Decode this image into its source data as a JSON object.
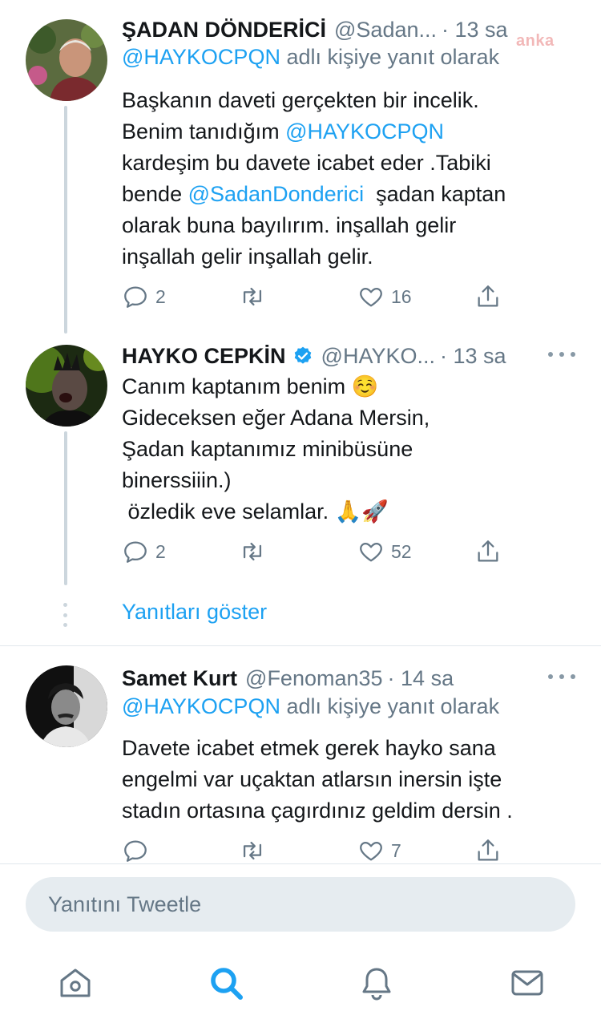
{
  "watermark": "anka",
  "tweets": [
    {
      "name": "ŞADAN DÖNDERİCİ",
      "handle": "@Sadan...",
      "time": "· 13 sa",
      "replying_mention": "@HAYKOCPQN",
      "replying_suffix": " adlı kişiye yanıt olarak",
      "text": {
        "p1": "Başkanın daveti gerçekten bir incelik.\nBenim tanıdığım ",
        "m1": "@HAYKOCPQN",
        "p2": "\nkardeşim bu davete icabet eder .Tabiki\nbende ",
        "m2": "@SadanDonderici",
        "p3": "  şadan kaptan\nolarak buna bayılırım. inşallah gelir\ninşallah gelir inşallah gelir."
      },
      "replies": "2",
      "retweets": "",
      "likes": "16"
    },
    {
      "name": "HAYKO CEPKİN",
      "handle": "@HAYKO...",
      "time": "· 13 sa",
      "verified": true,
      "text": "Canım kaptanım benim ☺️\nGideceksen eğer Adana Mersin,\nŞadan kaptanımız minibüsüne\nbinerssiiin.)\n özledik eve selamlar. 🙏🚀",
      "replies": "2",
      "retweets": "",
      "likes": "52"
    },
    {
      "name": "Samet Kurt",
      "handle": "@Fenoman35",
      "time": "· 14 sa",
      "replying_mention": "@HAYKOCPQN",
      "replying_suffix": " adlı kişiye yanıt olarak",
      "text": "Davete icabet etmek gerek hayko sana\nengelmi var uçaktan atlarsın inersin işte\nstadın ortasına çagırdınız geldim dersin .",
      "replies": "",
      "retweets": "",
      "likes": "7"
    }
  ],
  "show_replies": "Yanıtları göster",
  "reply_placeholder": "Yanıtını Tweetle",
  "tabs": [
    "home-icon",
    "search-icon",
    "notifications-icon",
    "messages-icon"
  ],
  "colors": {
    "accent": "#1da1f2",
    "muted": "#657786",
    "line": "#ccd6dd"
  }
}
